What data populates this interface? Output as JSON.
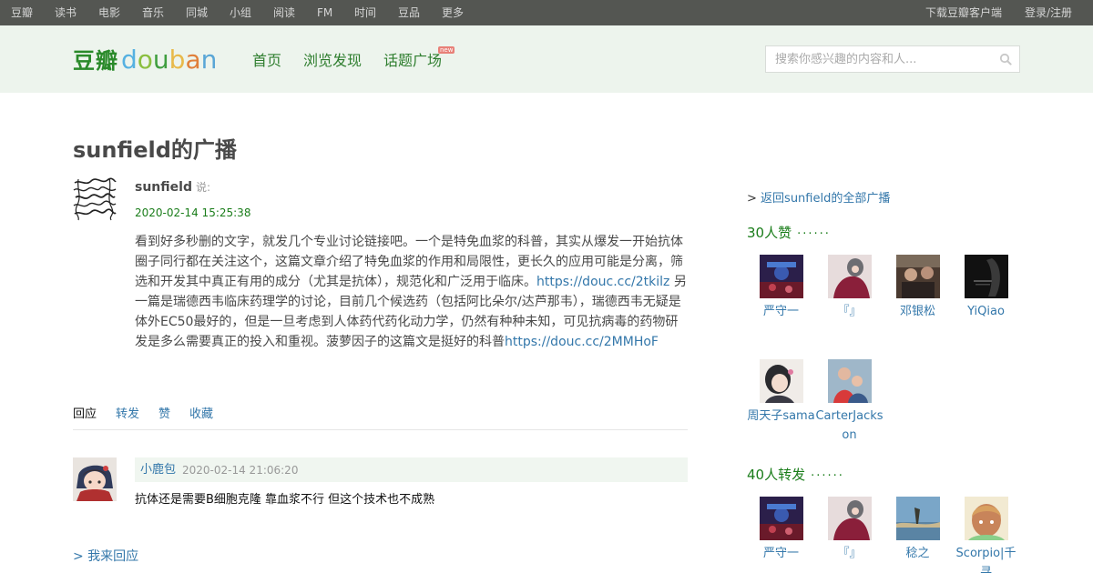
{
  "global_nav": {
    "items": [
      "豆瓣",
      "读书",
      "电影",
      "音乐",
      "同城",
      "小组",
      "阅读",
      "FM",
      "时间",
      "豆品",
      "更多"
    ],
    "download": "下载豆瓣客户端",
    "login": "登录/注册"
  },
  "header": {
    "logo_cn": "豆瓣",
    "logo_en_letters": [
      "d",
      "o",
      "u",
      "b",
      "a",
      "n"
    ],
    "logo_letter_colors": [
      "#56b1e1",
      "#8bbf3f",
      "#3f9e3f",
      "#e8b94a",
      "#e07f3a",
      "#5aa6d6"
    ],
    "nav": [
      "首页",
      "浏览发现",
      "话题广场"
    ],
    "new_badge": "new",
    "search_placeholder": "搜索你感兴趣的内容和人..."
  },
  "status": {
    "page_title": "sunfield的广播",
    "author": "sunfield",
    "said": "说:",
    "time": "2020-02-14 15:25:38",
    "body_1": "看到好多秒删的文字，就发几个专业讨论链接吧。一个是特免血浆的科普，其实从爆发一开始抗体圈子同行都在关注这个，这篇文章介绍了特免血浆的作用和局限性，更长久的应用可能是分离，筛选和开发其中真正有用的成分（尤其是抗体），规范化和广泛用于临床。",
    "link_1": "https://douc.cc/2tkilz",
    "body_2": " 另一篇是瑞德西韦临床药理学的讨论，目前几个候选药（包括阿比朵尔/达芦那韦），瑞德西韦无疑是体外EC50最好的，但是一旦考虑到人体药代药化动力学，仍然有种种未知，可见抗病毒的药物研发是多么需要真正的投入和重视。菠萝因子的这篇文是挺好的科普",
    "link_2": "https://douc.cc/2MMHoF"
  },
  "tabs": [
    "回应",
    "转发",
    "赞",
    "收藏"
  ],
  "reply": {
    "user": "小鹿包",
    "time": "2020-02-14 21:06:20",
    "text": "抗体还是需要B细胞克隆 靠血浆不行 但这个技术也不成熟"
  },
  "reply_action": "> 我来回应",
  "sidebar": {
    "back_link_prefix": ">",
    "back_link": "返回sunfield的全部广播",
    "likes_title": "30人赞",
    "reshares_title": "40人转发",
    "dots": "······",
    "likers": [
      "严守一",
      "『』",
      "邓银松",
      "YiQiao",
      "周天子sama",
      "CarterJackson"
    ],
    "resharers": [
      "严守一",
      "『』",
      "稔之",
      "Scorpio|千寻"
    ]
  }
}
